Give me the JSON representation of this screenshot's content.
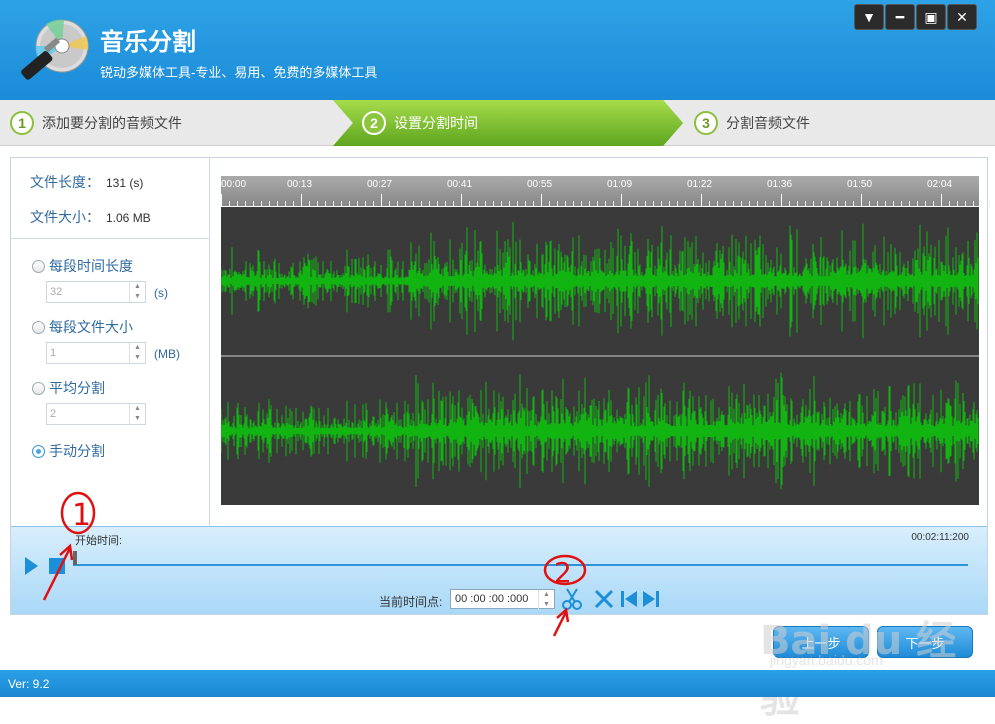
{
  "app": {
    "title": "音乐分割",
    "subtitle": "锐动多媒体工具-专业、易用、免费的多媒体工具",
    "version": "Ver: 9.2"
  },
  "window_buttons": [
    "▼",
    "━",
    "▣",
    "✕"
  ],
  "steps": [
    {
      "num": "1",
      "label": "添加要分割的音频文件"
    },
    {
      "num": "2",
      "label": "设置分割时间"
    },
    {
      "num": "3",
      "label": "分割音频文件"
    }
  ],
  "file_info": {
    "length_label": "文件长度：",
    "length_value": "131 (s)",
    "size_label": "文件大小：",
    "size_value": "1.06 MB"
  },
  "options": [
    {
      "label": "每段时间长度",
      "value": "32",
      "unit": "(s)",
      "selected": false
    },
    {
      "label": "每段文件大小",
      "value": "1",
      "unit": "(MB)",
      "selected": false
    },
    {
      "label": "平均分割",
      "value": "2",
      "unit": "",
      "selected": false
    },
    {
      "label": "手动分割",
      "selected": true
    }
  ],
  "timeline_ticks": [
    "00:00",
    "00:13",
    "00:27",
    "00:41",
    "00:55",
    "01:09",
    "01:22",
    "01:36",
    "01:50",
    "02:04"
  ],
  "player": {
    "start_label": "开始时间:",
    "end_time": "00:02:11:200",
    "current_label": "当前时间点:",
    "current_value": "00 :00 :00 :000"
  },
  "nav": {
    "prev": "上一步",
    "next": "下一步"
  },
  "watermark": {
    "text": "Bai du 经验",
    "sub": "jingyan.baidu.com"
  },
  "annotations": [
    "1",
    "2"
  ],
  "colors": {
    "header": "#1b8bd8",
    "active_step": "#8cc63f",
    "waveform": "#11b411",
    "waveform_bg": "#3a3a3a",
    "annotation": "#e01010"
  }
}
